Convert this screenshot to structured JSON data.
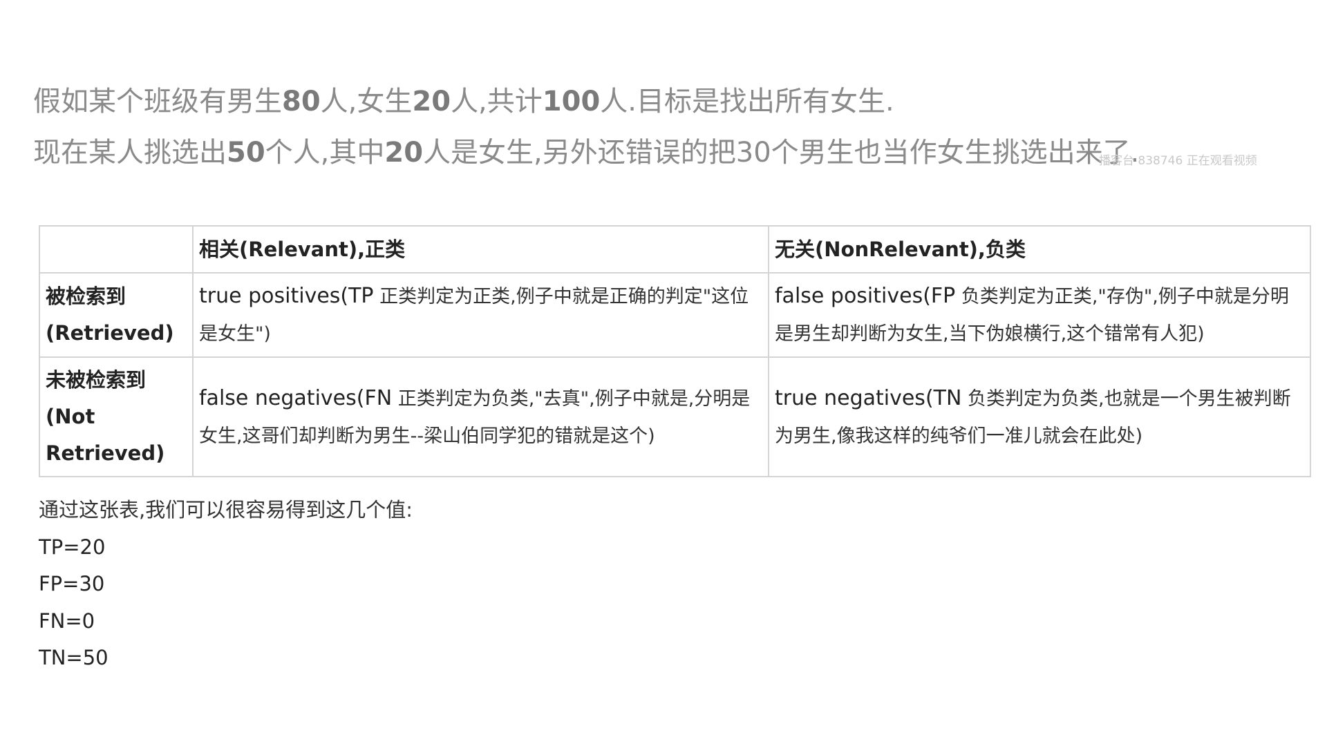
{
  "intro": {
    "line1": {
      "a": "假如某个班级有男生",
      "b": "80",
      "c": "人,女生",
      "d": "20",
      "e": "人,共计",
      "f": "100",
      "g": "人.目标是找出所有女生."
    },
    "line2": {
      "a": "现在某人挑选出",
      "b": "50",
      "c": "个人,其中",
      "d": "20",
      "e": "人是女生,另外还错误的把30个男生也当作女生挑选出来了."
    },
    "watermark": "播客台 838746 正在观看视频"
  },
  "table": {
    "header": {
      "corner": "",
      "relevant_en": "相关(Relevant),",
      "relevant_cn": "正类",
      "nonrelevant_en": "无关(NonRelevant),",
      "nonrelevant_cn": "负类"
    },
    "rows": [
      {
        "label_cn": "被检索到",
        "label_en": "(Retrieved)",
        "tp_en": "true positives(TP",
        "tp_cn": " 正类判定为正类,例子中就是正确的判定\"这位是女生\")",
        "fp_en": "false positives(FP",
        "fp_cn": " 负类判定为正类,\"存伪\",例子中就是分明是男生却判断为女生,当下伪娘横行,这个错常有人犯)"
      },
      {
        "label_cn": "未被检索到",
        "label_en": "(Not Retrieved)",
        "fn_en": "false negatives(FN",
        "fn_cn": " 正类判定为负类,\"去真\",例子中就是,分明是女生,这哥们却判断为男生--梁山伯同学犯的错就是这个)",
        "tn_en": "true negatives(TN",
        "tn_cn": " 负类判定为负类,也就是一个男生被判断为男生,像我这样的纯爷们一准儿就会在此处)"
      }
    ]
  },
  "summary": {
    "intro": "通过这张表,我们可以很容易得到这几个值:",
    "tp": "TP=20",
    "fp": "FP=30",
    "fn": "FN=0",
    "tn": "TN=50"
  }
}
